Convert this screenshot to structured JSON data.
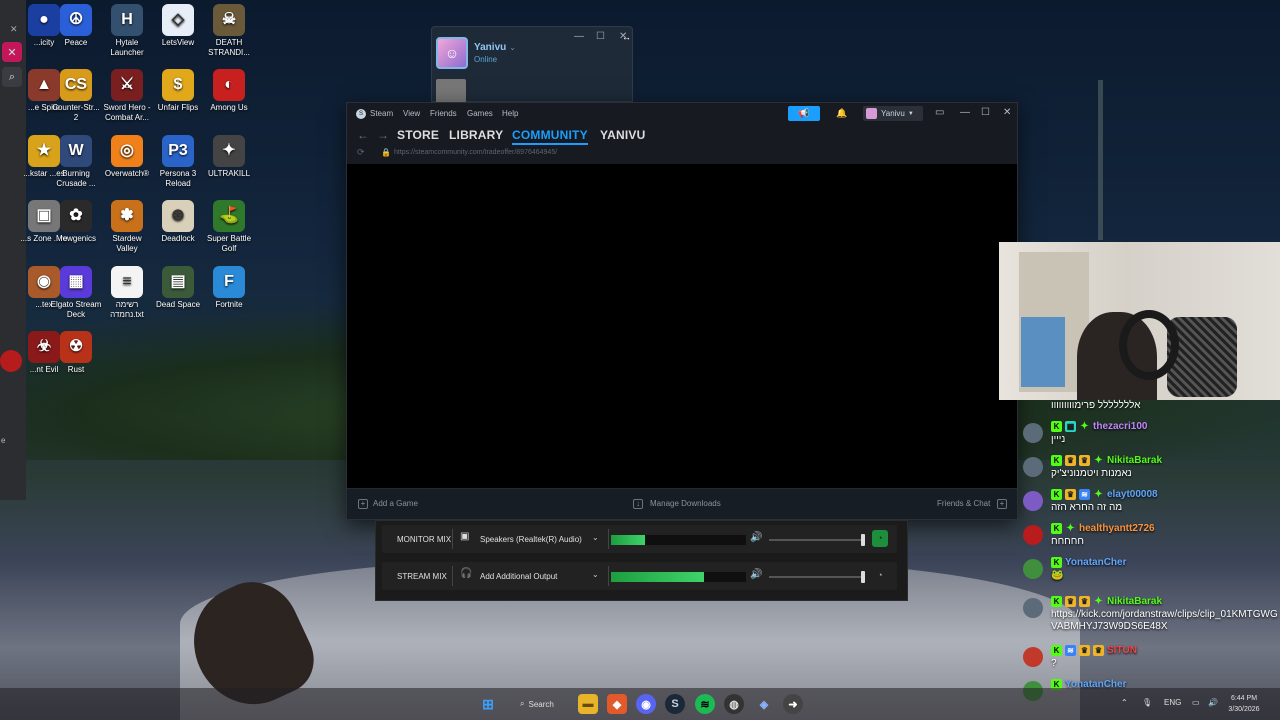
{
  "desktop": {
    "icons": [
      {
        "id": "cities",
        "label": "...icity",
        "glyph": "●",
        "color": "#1b3fa0"
      },
      {
        "id": "peace",
        "label": "Peace",
        "glyph": "☮",
        "color": "#2a5fd8"
      },
      {
        "id": "hytale",
        "label": "Hytale Launcher",
        "glyph": "H",
        "color": "#33506e"
      },
      {
        "id": "letsview",
        "label": "LetsView",
        "glyph": "◇",
        "color": "#e8eef7"
      },
      {
        "id": "death-stranding",
        "label": "DEATH STRANDI...",
        "glyph": "☠",
        "color": "#6a5a3a"
      },
      {
        "id": "slay-spire",
        "label": "...e Spire",
        "glyph": "▲",
        "color": "#8a3a2a"
      },
      {
        "id": "counter-strike",
        "label": "Counter-Str... 2",
        "glyph": "CS",
        "color": "#d89a1a"
      },
      {
        "id": "sword-hero",
        "label": "Sword Hero - Combat Ar...",
        "glyph": "⚔",
        "color": "#7a1f1f"
      },
      {
        "id": "unfair-flips",
        "label": "Unfair Flips",
        "glyph": "$",
        "color": "#e0a81a"
      },
      {
        "id": "among-us",
        "label": "Among Us",
        "glyph": "◐",
        "color": "#c81f1f"
      },
      {
        "id": "rockstar",
        "label": "...kstar ...es",
        "glyph": "★",
        "color": "#d8a21a"
      },
      {
        "id": "burning-crusade",
        "label": "Burning Crusade ...",
        "glyph": "W",
        "color": "#2f4a7a"
      },
      {
        "id": "overwatch",
        "label": "Overwatch®",
        "glyph": "◎",
        "color": "#f0801a"
      },
      {
        "id": "persona3",
        "label": "Persona 3 Reload",
        "glyph": "P3",
        "color": "#2a64c8"
      },
      {
        "id": "ultrakill",
        "label": "ULTRAKILL",
        "glyph": "✦",
        "color": "#444444"
      },
      {
        "id": "zone",
        "label": "...s Zone ...ro",
        "glyph": "▣",
        "color": "#777777"
      },
      {
        "id": "mewgenics",
        "label": "Mewgenics",
        "glyph": "✿",
        "color": "#2a2a2a"
      },
      {
        "id": "stardew",
        "label": "Stardew Valley",
        "glyph": "✽",
        "color": "#c8701a"
      },
      {
        "id": "deadlock",
        "label": "Deadlock",
        "glyph": "⊛",
        "color": "#d8d0b8"
      },
      {
        "id": "super-battle-golf",
        "label": "Super Battle Golf",
        "glyph": "⛳",
        "color": "#2f7a2a"
      },
      {
        "id": "vortex",
        "label": "...tex",
        "glyph": "◉",
        "color": "#a85a2a"
      },
      {
        "id": "elgato",
        "label": "Elgato Stream Deck",
        "glyph": "▦",
        "color": "#5a3ad8"
      },
      {
        "id": "text-file",
        "label": "רשימה נחמדה.txt",
        "glyph": "≡",
        "color": "#f4f4f4"
      },
      {
        "id": "dead-space",
        "label": "Dead Space",
        "glyph": "▤",
        "color": "#3a5a3a"
      },
      {
        "id": "fortnite",
        "label": "Fortnite",
        "glyph": "F",
        "color": "#2a8ad8"
      },
      {
        "id": "resident-evil",
        "label": "...nt Evil",
        "glyph": "☣",
        "color": "#8a1a1a"
      },
      {
        "id": "rust",
        "label": "Rust",
        "glyph": "☢",
        "color": "#b8321a"
      }
    ]
  },
  "friends_window": {
    "name": "Yanivu",
    "status": "Online"
  },
  "steam": {
    "menu": [
      "Steam",
      "View",
      "Friends",
      "Games",
      "Help"
    ],
    "user": "Yanivu",
    "tabs": [
      "STORE",
      "LIBRARY",
      "COMMUNITY",
      "YANIVU"
    ],
    "active_tab": "COMMUNITY",
    "url": "https://steamcommunity.com/tradeoffer/8976464945/",
    "bottom": {
      "add_game": "Add a Game",
      "manage_downloads": "Manage Downloads",
      "friends_chat": "Friends & Chat"
    }
  },
  "mixer": {
    "rows": [
      {
        "label": "MONITOR MIX",
        "device": "Speakers (Realtek(R) Audio)",
        "meter_level": 0.25,
        "volume": 0.98,
        "listening": true
      },
      {
        "label": "STREAM MIX",
        "device": "Add Additional Output",
        "meter_level": 0.69,
        "volume": 0.98,
        "listening": false
      }
    ]
  },
  "chat": {
    "messages": [
      {
        "user": "",
        "text": "אללללללל פרימווווווווו",
        "color": "#ffffff",
        "badges": []
      },
      {
        "user": "thezacri100",
        "text": "נייין",
        "color": "#c084fc",
        "badges": [
          "k",
          "teal",
          "star"
        ]
      },
      {
        "user": "NikitaBarak",
        "text": "נאמנות ויטמנוניצ'יק",
        "color": "#53fc18",
        "badges": [
          "k",
          "crown",
          "crown",
          "star"
        ]
      },
      {
        "user": "elayt00008",
        "text": "מה זה החרא הזה",
        "color": "#60a5fa",
        "badges": [
          "k",
          "crown",
          "blue",
          "star"
        ]
      },
      {
        "user": "healthyantt2726",
        "text": "חחחחח",
        "color": "#fb923c",
        "badges": [
          "k",
          "star"
        ]
      },
      {
        "user": "YonatanCher",
        "text": "🐸",
        "color": "#60a5fa",
        "badges": [
          "k"
        ]
      },
      {
        "user": "NikitaBarak",
        "text": "https://kick.com/jordanstraw/clips/clip_01KMTGWGVABMHYJ73W9DS6E48X",
        "color": "#53fc18",
        "badges": [
          "k",
          "crown",
          "crown",
          "star"
        ]
      },
      {
        "user": "SITUN",
        "text": "?",
        "color": "#ef4444",
        "badges": [
          "k",
          "blue",
          "crown",
          "crown"
        ]
      },
      {
        "user": "YonatanCher",
        "text": "",
        "color": "#60a5fa",
        "badges": [
          "k"
        ]
      }
    ]
  },
  "taskbar": {
    "search_label": "Search",
    "lang": "ENG",
    "time": "6:44 PM",
    "date": "3/30/2026"
  },
  "colors": {
    "steam_accent": "#1a9fff",
    "kick_green": "#53fc18",
    "mixer_green": "#2ecc5a"
  }
}
